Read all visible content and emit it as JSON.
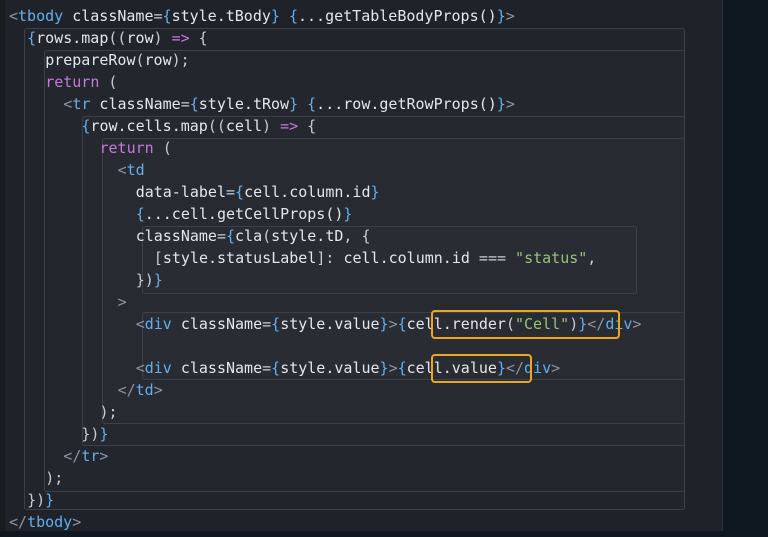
{
  "editor": {
    "lines": [
      [
        [
          "tag",
          "<"
        ],
        [
          "tagn",
          "tbody"
        ],
        [
          "attr",
          " className"
        ],
        [
          "pun",
          "="
        ],
        [
          "br1",
          "{"
        ],
        [
          "id",
          "style.tBody"
        ],
        [
          "br1",
          "}"
        ],
        [
          "pun",
          " "
        ],
        [
          "br1",
          "{"
        ],
        [
          "id",
          "...getTableBodyProps()"
        ],
        [
          "br1",
          "}"
        ],
        [
          "tag",
          ">"
        ]
      ],
      [
        [
          "br1",
          "{"
        ],
        [
          "id",
          "rows.map"
        ],
        [
          "pun",
          "(("
        ],
        [
          "id",
          "row"
        ],
        [
          "pun",
          ") "
        ],
        [
          "op",
          "=>"
        ],
        [
          "pun",
          " {"
        ]
      ],
      [
        [
          "fn",
          "prepareRow"
        ],
        [
          "pun",
          "("
        ],
        [
          "id",
          "row"
        ],
        [
          "pun",
          ");"
        ]
      ],
      [
        [
          "kw",
          "return"
        ],
        [
          "pun",
          " ("
        ]
      ],
      [
        [
          "tag",
          "<"
        ],
        [
          "tagn",
          "tr"
        ],
        [
          "attr",
          " className"
        ],
        [
          "pun",
          "="
        ],
        [
          "br1",
          "{"
        ],
        [
          "id",
          "style.tRow"
        ],
        [
          "br1",
          "}"
        ],
        [
          "pun",
          " "
        ],
        [
          "br1",
          "{"
        ],
        [
          "id",
          "...row.getRowProps()"
        ],
        [
          "br1",
          "}"
        ],
        [
          "tag",
          ">"
        ]
      ],
      [
        [
          "br1",
          "{"
        ],
        [
          "id",
          "row.cells.map"
        ],
        [
          "pun",
          "(("
        ],
        [
          "id",
          "cell"
        ],
        [
          "pun",
          ") "
        ],
        [
          "op",
          "=>"
        ],
        [
          "pun",
          " {"
        ]
      ],
      [
        [
          "kw",
          "return"
        ],
        [
          "pun",
          " ("
        ]
      ],
      [
        [
          "tag",
          "<"
        ],
        [
          "tagn",
          "td"
        ]
      ],
      [
        [
          "attr",
          "data-label"
        ],
        [
          "pun",
          "="
        ],
        [
          "br1",
          "{"
        ],
        [
          "id",
          "cell.column.id"
        ],
        [
          "br1",
          "}"
        ]
      ],
      [
        [
          "br1",
          "{"
        ],
        [
          "id",
          "...cell.getCellProps()"
        ],
        [
          "br1",
          "}"
        ]
      ],
      [
        [
          "attr",
          "className"
        ],
        [
          "pun",
          "="
        ],
        [
          "br1",
          "{"
        ],
        [
          "fn",
          "cla"
        ],
        [
          "pun",
          "("
        ],
        [
          "id",
          "style.tD"
        ],
        [
          "pun",
          ", {"
        ]
      ],
      [
        [
          "pun",
          "["
        ],
        [
          "id",
          "style.statusLabel"
        ],
        [
          "pun",
          "]: "
        ],
        [
          "id",
          "cell.column.id"
        ],
        [
          "pun",
          " === "
        ],
        [
          "str",
          "\"status\""
        ],
        [
          "pun",
          ","
        ]
      ],
      [
        [
          "pun",
          "})"
        ],
        [
          "br1",
          "}"
        ]
      ],
      [
        [
          "tag",
          ">"
        ]
      ],
      [
        [
          "tag",
          "<"
        ],
        [
          "tagn",
          "div"
        ],
        [
          "attr",
          " className"
        ],
        [
          "pun",
          "="
        ],
        [
          "br1",
          "{"
        ],
        [
          "id",
          "style.value"
        ],
        [
          "br1",
          "}"
        ],
        [
          "tag",
          ">"
        ],
        [
          "br1",
          "{"
        ],
        [
          "id",
          "cell.render"
        ],
        [
          "pun",
          "("
        ],
        [
          "str",
          "\"Cell\""
        ],
        [
          "pun",
          ")"
        ],
        [
          "br1",
          "}"
        ],
        [
          "tag",
          "</"
        ],
        [
          "tagn",
          "div"
        ],
        [
          "tag",
          ">"
        ]
      ],
      [],
      [
        [
          "tag",
          "<"
        ],
        [
          "tagn",
          "div"
        ],
        [
          "attr",
          " className"
        ],
        [
          "pun",
          "="
        ],
        [
          "br1",
          "{"
        ],
        [
          "id",
          "style.value"
        ],
        [
          "br1",
          "}"
        ],
        [
          "tag",
          ">"
        ],
        [
          "br1",
          "{"
        ],
        [
          "id",
          "cell.value"
        ],
        [
          "br1",
          "}"
        ],
        [
          "tag",
          "</"
        ],
        [
          "tagn",
          "div"
        ],
        [
          "tag",
          ">"
        ]
      ],
      [
        [
          "tag",
          "</"
        ],
        [
          "tagn",
          "td"
        ],
        [
          "tag",
          ">"
        ]
      ],
      [
        [
          "pun",
          ");"
        ]
      ],
      [
        [
          "pun",
          "})"
        ],
        [
          "br1",
          "}"
        ]
      ],
      [
        [
          "tag",
          "</"
        ],
        [
          "tagn",
          "tr"
        ],
        [
          "tag",
          ">"
        ]
      ],
      [
        [
          "pun",
          ");"
        ]
      ],
      [
        [
          "pun",
          "})"
        ],
        [
          "br1",
          "}"
        ]
      ],
      [
        [
          "tag",
          "</"
        ],
        [
          "tagn",
          "tbody"
        ],
        [
          "tag",
          ">"
        ]
      ]
    ],
    "indents": [
      0,
      2,
      4,
      4,
      6,
      8,
      10,
      12,
      14,
      14,
      14,
      16,
      14,
      12,
      14,
      0,
      14,
      12,
      10,
      8,
      6,
      4,
      2,
      0
    ],
    "highlights": [
      "cell.render(\"Cell\")",
      "cell.value"
    ]
  }
}
